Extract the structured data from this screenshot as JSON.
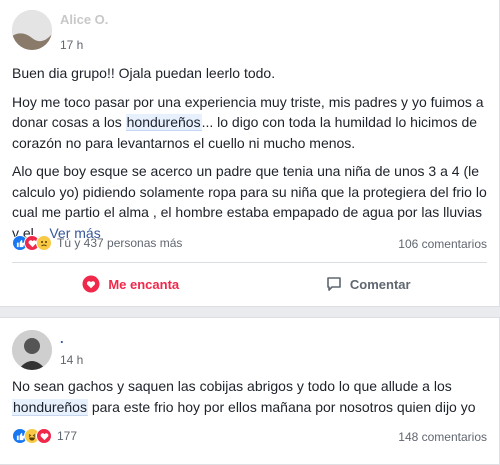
{
  "post1": {
    "author": "Alice O.",
    "time": "17 h",
    "paragraph1": "Buen dia grupo!! Ojala puedan leerlo todo.",
    "p2_before": "Hoy me toco pasar por una experiencia muy triste, mis padres y yo fuimos a donar cosas a los ",
    "p2_highlight": "hondureños",
    "p2_after": "... lo digo con toda la humildad lo hicimos de corazón no para levantarnos el cuello ni mucho menos.",
    "p3": "Alo que boy esque se acerco un padre que tenia una niña de unos 3 a 4 (le calculo yo) pidiendo solamente ropa para su niña que la protegiera del frio lo cual me partio el alma , el hombre estaba empapado de agua por las lluvias y el... ",
    "see_more": "Ver más",
    "reactions_text": "Tú y 437 personas más",
    "comments": "106 comentarios",
    "love_label": "Me encanta",
    "comment_label": "Comentar"
  },
  "post2": {
    "author": ".",
    "time": "14 h",
    "text_before": "No sean gachos y saquen las cobijas abrigos y todo lo que allude a los ",
    "text_highlight": "hondureños",
    "text_after": " para este frio hoy por ellos mañana por nosotros quien dijo yo",
    "reactions_count": "177",
    "comments": "148 comentarios"
  },
  "colors": {
    "accent": "#365899",
    "love": "#f0284a",
    "like": "#1877f2"
  },
  "icons": [
    "like-reaction-icon",
    "love-reaction-icon",
    "sad-reaction-icon",
    "haha-reaction-icon",
    "heart-outline-icon",
    "comment-bubble-icon"
  ]
}
